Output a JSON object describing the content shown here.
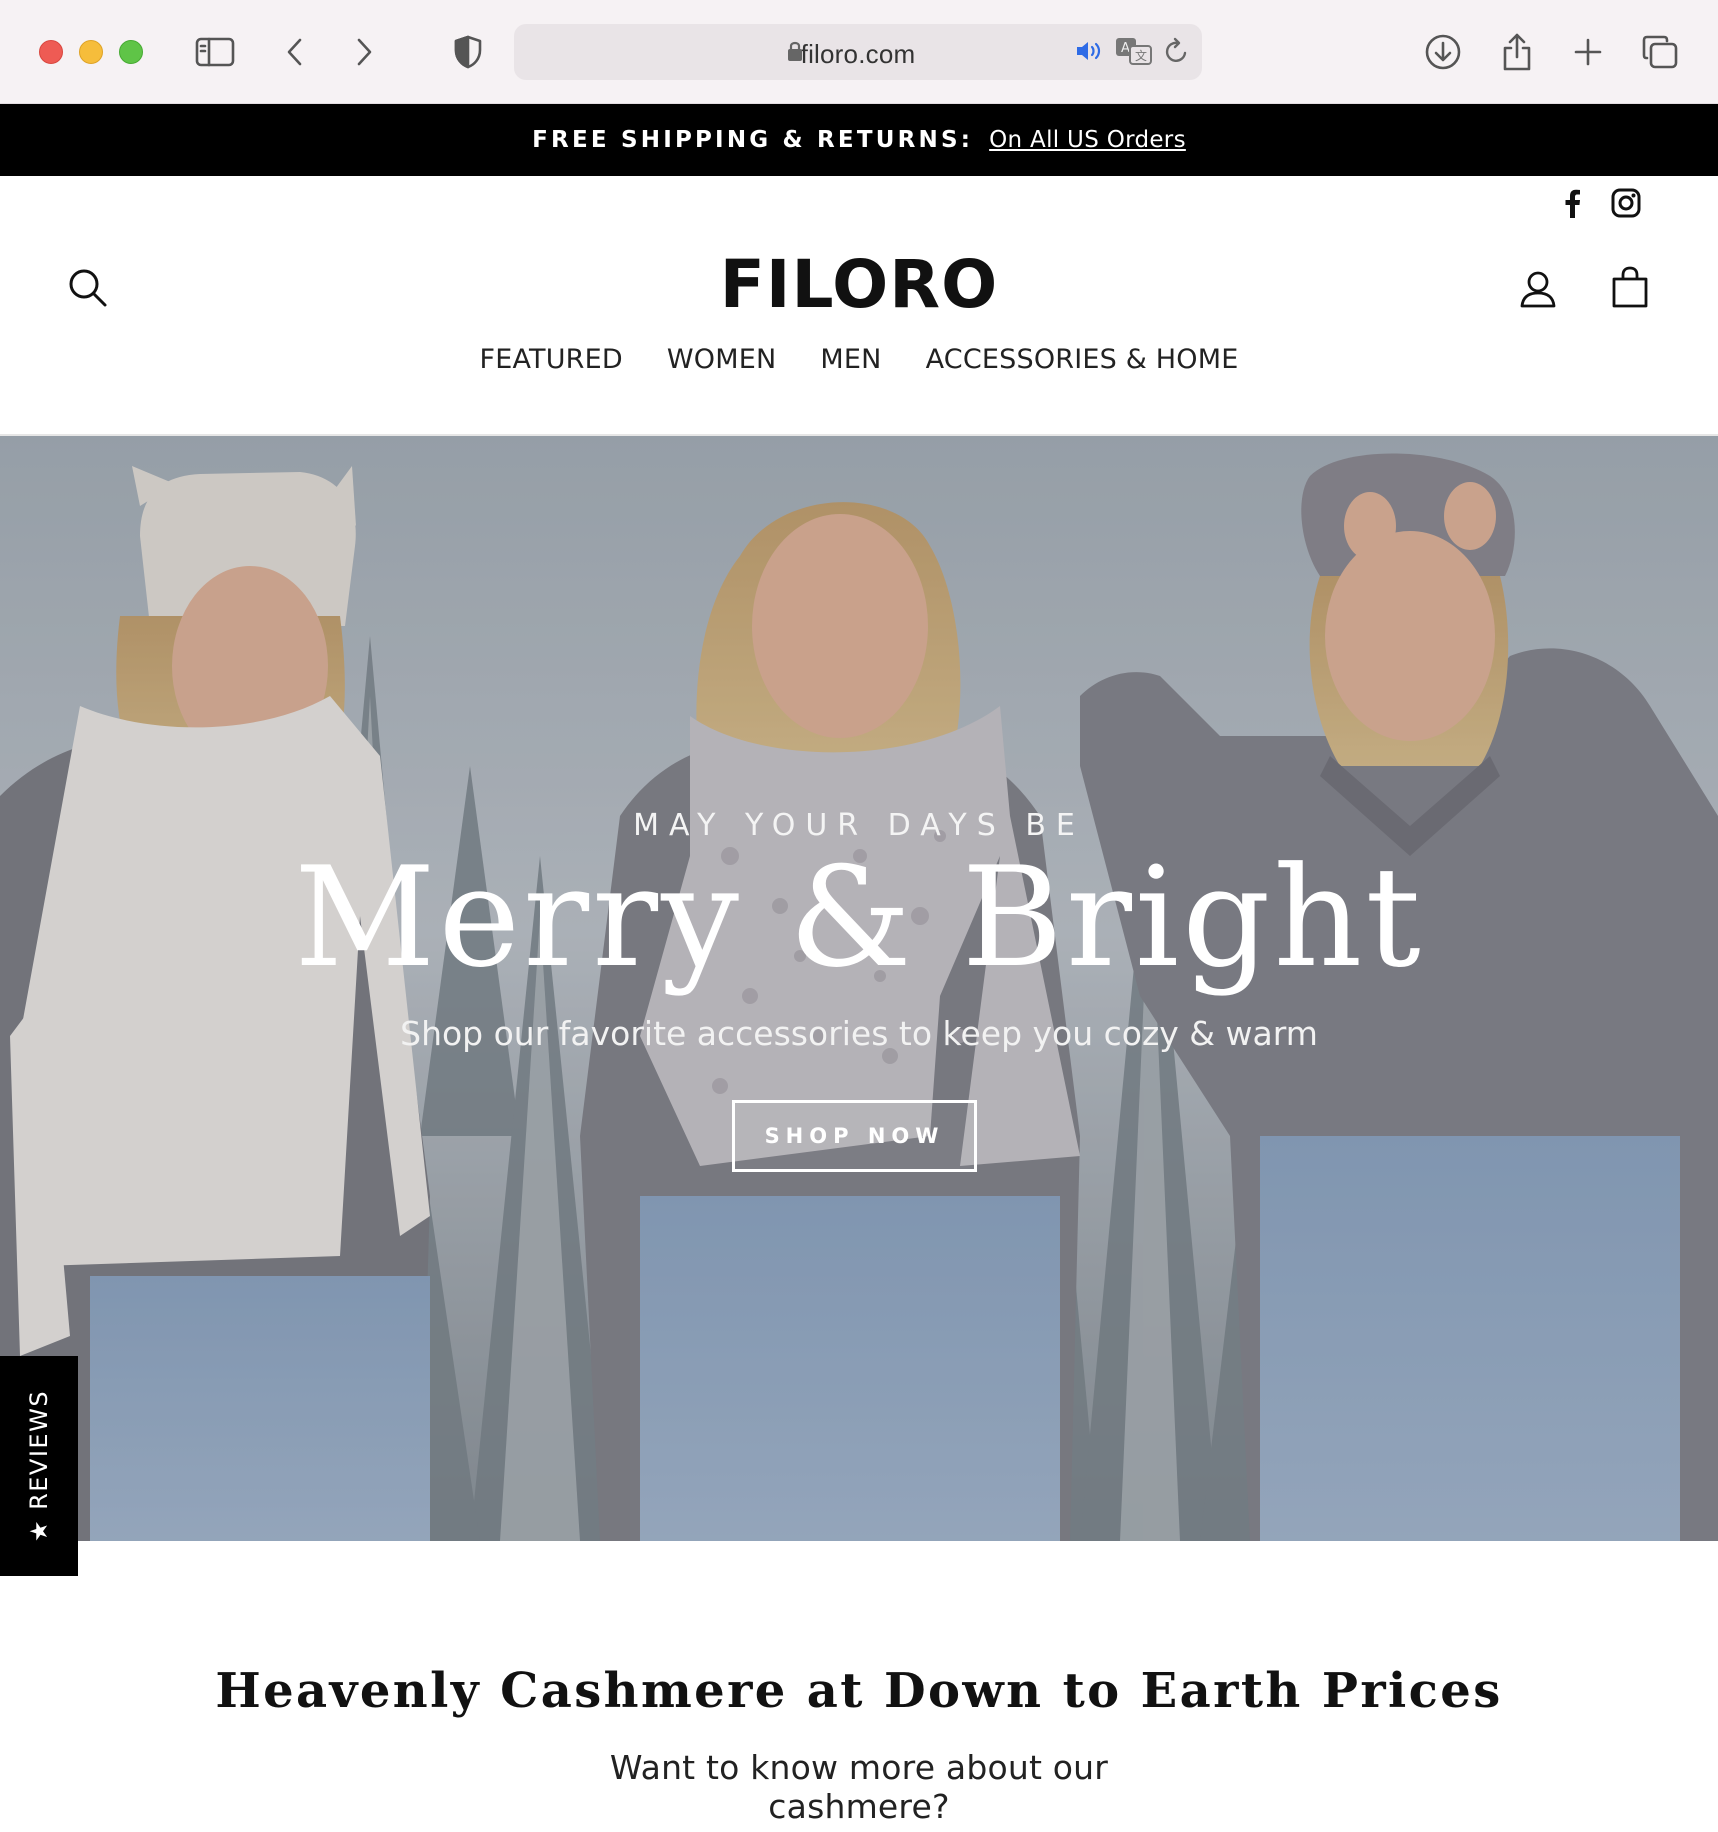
{
  "browser": {
    "url": "filoro.com",
    "icons": [
      "sidebar-icon",
      "back-icon",
      "forward-icon",
      "shield-icon",
      "lock-icon",
      "audio-icon",
      "translate-icon",
      "reload-icon",
      "download-icon",
      "share-icon",
      "new-tab-icon",
      "tabs-overview-icon"
    ]
  },
  "promo": {
    "label": "FREE SHIPPING & RETURNS:",
    "link": "On All US Orders"
  },
  "header": {
    "logo": "FILORO",
    "social_icons": [
      "facebook-icon",
      "instagram-icon"
    ],
    "utility_icons": [
      "search-icon",
      "account-icon",
      "cart-icon"
    ]
  },
  "nav": {
    "items": [
      {
        "label": "FEATURED"
      },
      {
        "label": "WOMEN"
      },
      {
        "label": "MEN"
      },
      {
        "label": "ACCESSORIES & HOME"
      }
    ]
  },
  "hero": {
    "kicker": "MAY YOUR DAYS BE",
    "headline": "Merry & Bright",
    "subline": "Shop our favorite accessories to keep you cozy & warm",
    "cta": "SHOP NOW"
  },
  "reviews_tab": {
    "label": "★ REVIEWS"
  },
  "section": {
    "tagline": "Heavenly Cashmere at Down to Earth Prices",
    "link": "Want to know more about our cashmere?"
  },
  "colors": {
    "promo_bg": "#000000",
    "text": "#111111",
    "hero_text": "#ffffff"
  }
}
